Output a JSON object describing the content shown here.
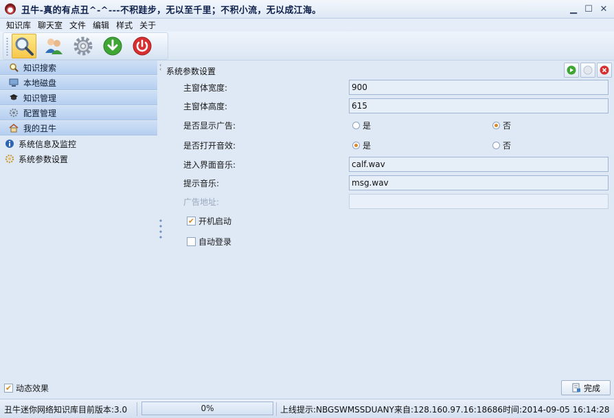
{
  "window": {
    "title": "丑牛-真的有点丑^-^---不积跬步，无以至千里；不积小流，无以成江海。",
    "minimize_glyph": "▁",
    "maximize_glyph": "☐",
    "close_glyph": "✕"
  },
  "menu": [
    "知识库",
    "聊天室",
    "文件",
    "编辑",
    "样式",
    "关于"
  ],
  "toolbar": {
    "buttons": [
      {
        "icon": "magnifier-icon",
        "active": true
      },
      {
        "icon": "users-icon",
        "active": false
      },
      {
        "icon": "gear-icon",
        "active": false
      },
      {
        "icon": "download-icon",
        "active": false
      },
      {
        "icon": "power-icon",
        "active": false
      }
    ]
  },
  "sidebar": {
    "nav": [
      {
        "label": "知识搜索",
        "icon": "search-icon"
      },
      {
        "label": "本地磁盘",
        "icon": "computer-icon"
      },
      {
        "label": "知识管理",
        "icon": "graduation-cap-icon"
      },
      {
        "label": "配置管理",
        "icon": "gear-icon"
      },
      {
        "label": "我的丑牛",
        "icon": "home-icon"
      }
    ],
    "tree": [
      {
        "label": "系统信息及监控",
        "icon": "info-icon"
      },
      {
        "label": "系统参数设置",
        "icon": "settings-icon"
      }
    ],
    "dynamic_effect": {
      "label": "动态效果",
      "checked": true
    }
  },
  "panel": {
    "title": "系统参数设置",
    "width_label": "主窗体宽度:",
    "width_value": "900",
    "height_label": "主窗体高度:",
    "height_value": "615",
    "ads_label": "是否显示广告:",
    "ads_yes": "是",
    "ads_no": "否",
    "ads_selected": "否",
    "sound_label": "是否打开音效:",
    "sound_yes": "是",
    "sound_no": "否",
    "sound_selected": "是",
    "music_label": "进入界面音乐:",
    "music_value": "calf.wav",
    "tip_label": "提示音乐:",
    "tip_value": "msg.wav",
    "ad_url_label": "广告地址:",
    "ad_url_value": "",
    "autostart": {
      "label": "开机启动",
      "checked": true
    },
    "autologin": {
      "label": "自动登录",
      "checked": false
    },
    "finish_label": "完成"
  },
  "status": {
    "version": "丑牛迷你网络知识库目前版本:3.0",
    "progress_percent": 0,
    "progress_text": "0%",
    "message": "上线提示:NBGSWMSSDUANY来自:128.160.97.16:18686时间:2014-09-05 16:14:28"
  },
  "colors": {
    "accent_orange": "#d9882a",
    "green_action": "#3fa535",
    "red_action": "#d83030"
  }
}
